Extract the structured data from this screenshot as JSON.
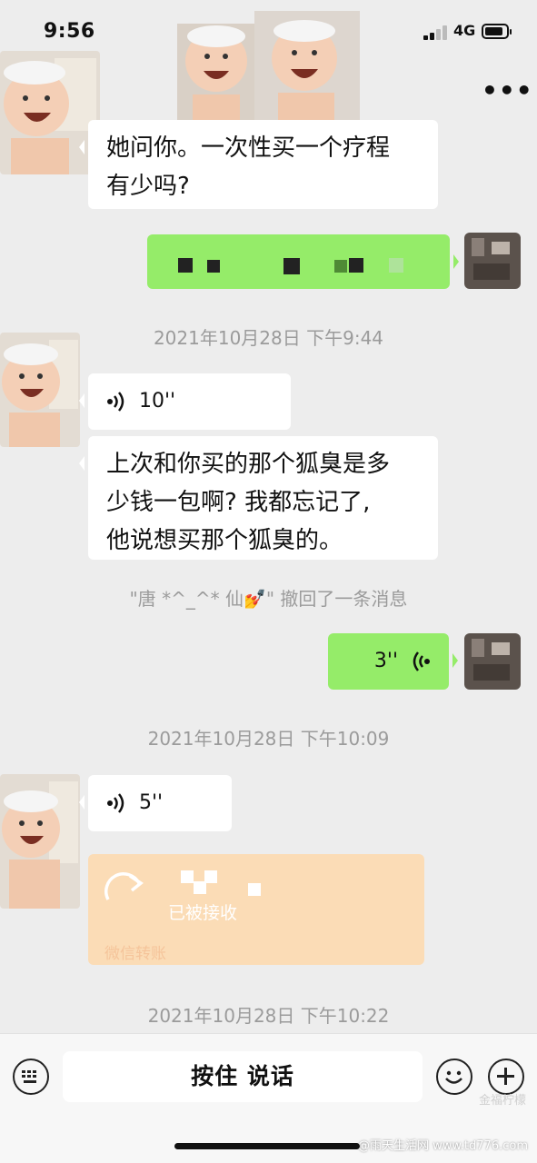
{
  "status": {
    "time": "9:56",
    "network": "4G",
    "battery_level": 0.85
  },
  "header": {
    "more_label": "•••"
  },
  "messages": {
    "m1_text_line1": "她问你。一次性买一个疗程",
    "m1_text_line2": "有少吗?",
    "ts1": "2021年10月28日 下午9:44",
    "voice1": "10''",
    "m2_line1": "上次和你买的那个狐臭是多",
    "m2_line2": "少钱一包啊? 我都忘记了,",
    "m2_line3": "他说想买那个狐臭的。",
    "recall": "\"唐   *^_^*   仙💅\" 撤回了一条消息",
    "voice_self": "3''",
    "ts2": "2021年10月28日 下午10:09",
    "voice2": "5''",
    "transfer_status": "已被接收",
    "transfer_footer": "微信转账",
    "ts3": "2021年10月28日 下午10:22"
  },
  "input_bar": {
    "talk_label": "按住 说话"
  },
  "watermark": {
    "line1": "金福柠檬",
    "line2": "@雨天生活网 www.td776.com"
  },
  "colors": {
    "background": "#ededed",
    "self_bubble": "#95ec69",
    "transfer": "#fbdcb6"
  },
  "icons": [
    "keyboard-icon",
    "emoji-icon",
    "plus-icon",
    "voice-wave-icon",
    "more-dots-icon",
    "transfer-arrow-icon"
  ]
}
